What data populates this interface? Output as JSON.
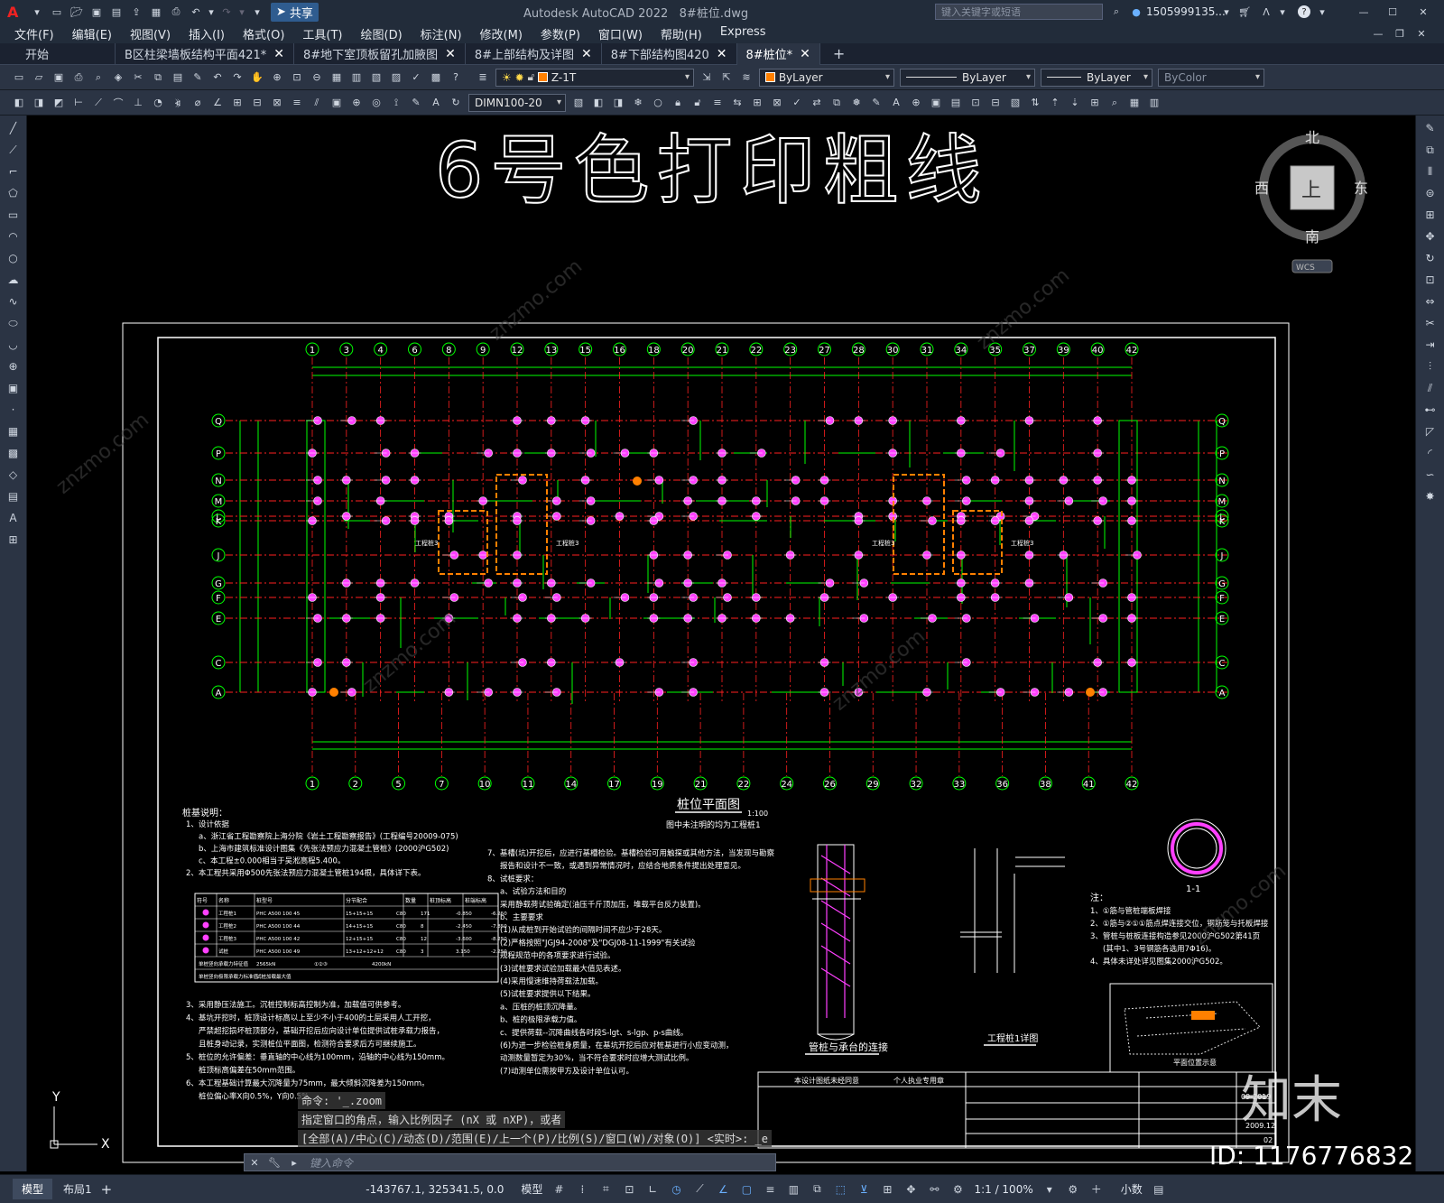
{
  "titlebar": {
    "app_title": "Autodesk AutoCAD 2022",
    "file_title": "8#桩位.dwg",
    "share_label": "共享",
    "search_placeholder": "键入关键字或短语",
    "user": "1505999135...",
    "logo": "A"
  },
  "menu": [
    "文件(F)",
    "编辑(E)",
    "视图(V)",
    "插入(I)",
    "格式(O)",
    "工具(T)",
    "绘图(D)",
    "标注(N)",
    "修改(M)",
    "参数(P)",
    "窗口(W)",
    "帮助(H)",
    "Express"
  ],
  "tabs": [
    {
      "label": "开始",
      "active": false,
      "closable": false
    },
    {
      "label": "B区柱梁墙板结构平面421*",
      "active": false,
      "closable": true
    },
    {
      "label": "8#地下室顶板留孔加腋图",
      "active": false,
      "closable": true
    },
    {
      "label": "8#上部结构及详图",
      "active": false,
      "closable": true
    },
    {
      "label": "8#下部结构图420",
      "active": false,
      "closable": true
    },
    {
      "label": "8#桩位*",
      "active": true,
      "closable": true
    }
  ],
  "toolbar": {
    "layer": "Z-1T",
    "color": "ByLayer",
    "linetype": "ByLayer",
    "lineweight": "ByLayer",
    "plotstyle": "ByColor",
    "dimstyle": "DIMN100-20",
    "layer_color": "#ff8000",
    "color_swatch": "#ff8000"
  },
  "viewcube": {
    "north": "北",
    "south": "南",
    "east": "东",
    "west": "西",
    "top": "上",
    "wcs": "WCS"
  },
  "drawing": {
    "heading": "6号色打印粗线",
    "plan_title": "桩位平面图",
    "plan_scale": "1:100",
    "plan_note": "图中未注明的均为工程桩1",
    "notes_title": "桩基说明：",
    "notes_col1": [
      "1、设计依据",
      "a、浙江省工程勘察院上海分院《岩土工程勘察报告》(工程编号20009-075)",
      "b、上海市建筑标准设计图集《先张法预应力混凝土管桩》(2000沪G502)",
      "c、本工程±0.000相当于吴淞高程5.400。",
      "2、本工程共采用Φ500先张法预应力混凝土管桩194根，具体详下表。",
      "3、采用静压法施工。沉桩控制标高控制为准，加载值可供参考。",
      "4、基坑开挖时，桩顶设计标高以上至少不小于400的土层采用人工开挖，",
      "严禁超挖损坏桩顶部分，基础开挖后应向设计单位提供试桩承载力报告，",
      "且桩身动记录，实测桩位平面图，检测符合要求后方可继续施工。",
      "5、桩位的允许偏差：垂直轴的中心线为100mm，沿轴的中心线为150mm。",
      "桩顶标高偏差在50mm范围。",
      "6、本工程基础计算最大沉降量为75mm，最大倾斜沉降差为150mm。",
      "桩位偏心率X向0.5%，Y向0.5%"
    ],
    "notes_col2": [
      "7、基槽(坑)开挖后，应进行基槽检验。基槽检验可用触探或其他方法，当发现与勘察",
      "报告和设计不一致，或遇到异常情况时，应结合地质条件提出处理意见。",
      "8、试桩要求：",
      "a、试验方法和目的",
      "采用静载荷试验确定(油压千斤顶加压，堆载平台反力装置)。",
      "b、主要要求",
      "(1)从成桩到开始试验的间隔时间不应少于28天。",
      "(2)严格按照\"JGJ94-2008\"及\"DGJ08-11-1999\"有关试验",
      "规程规范中的各项要求进行试验。",
      "(3)试桩要求试验加载最大值见表述。",
      "(4)采用慢速维持荷载法加载。",
      "(5)试桩要求提供以下结果。",
      "a、压桩的桩顶沉降量。",
      "b、桩的极限承载力值。",
      "c、提供荷载--沉降曲线各时段S-lgt、s-lgp、p-s曲线。",
      "(6)为进一步检验桩身质量，在基坑开挖后应对桩基进行小应变动测，",
      "动测数量暂定为30%，当不符合要求时应增大测试比例。",
      "(7)动测单位需按甲方及设计单位认可。"
    ],
    "legend_table": {
      "headers": [
        "符号",
        "名称",
        "桩型号",
        "分节配合",
        "数量",
        "桩顶标高",
        "桩端标高"
      ],
      "rows": [
        [
          "",
          "工程桩1",
          "PHC A500 100 45",
          "15+15+15",
          "C80",
          "171",
          "-0.850",
          "-6.250"
        ],
        [
          "",
          "工程桩2",
          "PHC A500 100 44",
          "14+15+15",
          "C80",
          "8",
          "-2.450",
          "-7.850"
        ],
        [
          "",
          "工程桩3",
          "PHC A500 100 42",
          "12+15+15",
          "C80",
          "12",
          "-3.600",
          "-8.250"
        ],
        [
          "",
          "试桩",
          "PHC A500 100 49",
          "13+12+12+12",
          "C80",
          "3",
          "3.150",
          "-2.250"
        ]
      ],
      "footer": [
        [
          "单桩竖向承载力特征值",
          "2565kN",
          "①②③",
          "4200kN"
        ],
        [
          "单桩竖向极限承载力标准值",
          "试桩加载最大值",
          "",
          ""
        ]
      ]
    },
    "detail1_title": "管桩与承台的连接",
    "detail2_title": "工程桩1详图",
    "section_title": "1-1",
    "notes3_title": "注：",
    "notes3": [
      "1、①筋与管桩端板焊接",
      "2、①筋与②①①筋点焊连接交位，钢筋笼与托板焊接",
      "3、管桩与桩板连接构造参见2000沪G502第41页",
      "(其中1、3号钢筋各选用7Φ16)。",
      "4、具体未详处详见图集2000沪G502。"
    ],
    "keymap_title": "平面位置示意",
    "titleblock": {
      "a": "本设计图纸未经同意",
      "b": "个人执业专用章",
      "c": "2009.12",
      "d": "09-2019",
      "e": "02"
    },
    "axes_top": [
      "1",
      "3",
      "4",
      "6",
      "8",
      "9",
      "12",
      "13",
      "15",
      "16",
      "18",
      "20",
      "21",
      "22",
      "23",
      "27",
      "28",
      "30",
      "31",
      "34",
      "35",
      "37",
      "39",
      "40",
      "42"
    ],
    "axes_bottom": [
      "1",
      "2",
      "5",
      "7",
      "10",
      "11",
      "14",
      "17",
      "19",
      "21",
      "22",
      "24",
      "26",
      "29",
      "32",
      "33",
      "36",
      "38",
      "41",
      "42"
    ],
    "axes_side": [
      "Q",
      "P",
      "N",
      "M",
      "L",
      "K",
      "J",
      "G",
      "F",
      "E",
      "C",
      "A"
    ],
    "pile_label": "工程桩3"
  },
  "command": {
    "history1": "命令: '_.zoom",
    "history2": "指定窗口的角点，输入比例因子 (nX 或 nXP)，或者",
    "history3": "[全部(A)/中心(C)/动态(D)/范围(E)/上一个(P)/比例(S)/窗口(W)/对象(O)] <实时>: _e",
    "placeholder": "键入命令"
  },
  "status": {
    "model_tab": "模型",
    "layout_tab": "布局1",
    "coords": "-143767.1, 325341.5, 0.0",
    "space": "模型",
    "scale": "1:1 / 100%",
    "units": "小数"
  },
  "watermark": {
    "id": "ID: 1176776832",
    "brand": "知末",
    "site": "znzmo.com",
    "cn": "知末网"
  }
}
